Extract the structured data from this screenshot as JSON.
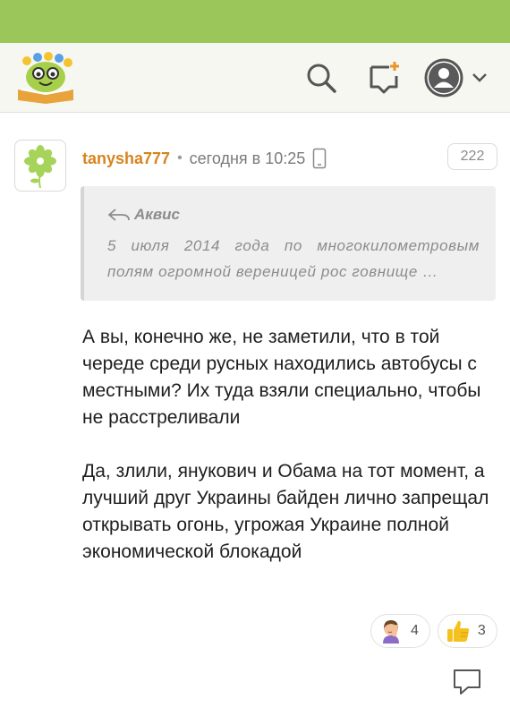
{
  "header": {
    "logo": "smiling-book-logo",
    "icons": [
      "search-icon",
      "new-post-icon",
      "user-avatar-icon",
      "chevron-down-icon"
    ],
    "accent_color": "#9bc75a"
  },
  "comment": {
    "author": "tanysha777",
    "separator": "•",
    "time": "сегодня в 10:25",
    "device_icon": "mobile-phone-icon",
    "avatar_icon": "flower-icon",
    "rating": "222",
    "quote": {
      "author": "Аквис",
      "text": "5 июля 2014 года по многокилометровым полям огромной вереницей рос говнище …"
    },
    "paragraphs": [
      "А вы, конечно же, не заметили, что в той череде среди русных находились автобусы с местными? Их туда взяли специально, чтобы не расстреливали",
      "Да, злили, янукович и Обама на тот момент, а лучший друг Украины байден лично запрещал открывать огонь, угрожая Украине полной экономической блокадой"
    ],
    "reactions": [
      {
        "icon": "facepalm-icon",
        "count": "4"
      },
      {
        "icon": "thumbs-up-icon",
        "count": "3"
      }
    ],
    "reply_icon": "reply-bubble-icon",
    "username_color": "#d8841f"
  }
}
